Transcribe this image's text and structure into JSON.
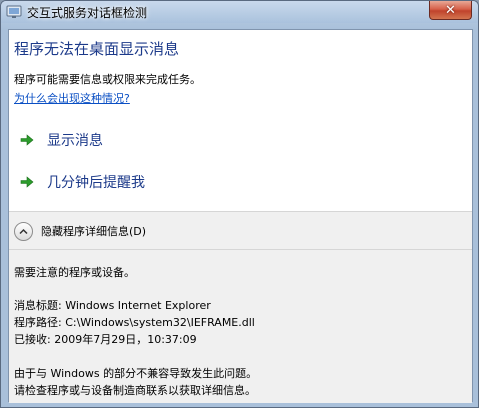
{
  "window": {
    "title": "交互式服务对话框检测",
    "close_glyph": "✕"
  },
  "main": {
    "heading": "程序无法在桌面显示消息",
    "description": "程序可能需要信息或权限来完成任务。",
    "help_link": "为什么会出现这种情况?",
    "commands": [
      {
        "label": "显示消息",
        "icon": "green-arrow-icon"
      },
      {
        "label": "几分钟后提醒我",
        "icon": "green-arrow-icon"
      }
    ]
  },
  "details": {
    "toggle_label": "隐藏程序详细信息(D)",
    "toggle_icon": "chevron-up-icon",
    "notice": "需要注意的程序或设备。",
    "message_title": "消息标题: Windows Internet Explorer",
    "program_path": "程序路径: C:\\Windows\\system32\\IEFRAME.dll",
    "received": "已接收: 2009年7月29日，10:37:09",
    "explanation_1": "由于与 Windows 的部分不兼容导致发生此问题。",
    "explanation_2": "请检查程序或与设备制造商联系以获取详细信息。"
  },
  "colors": {
    "heading": "#1c3a8a",
    "link": "#0a4fc4",
    "arrow": "#2c9c2c",
    "details_bg": "#f0f0f0"
  }
}
